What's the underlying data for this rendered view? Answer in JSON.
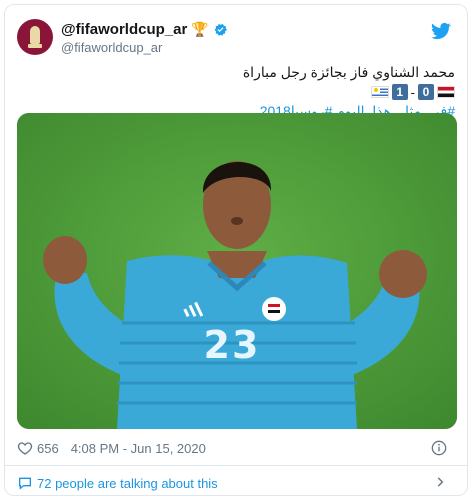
{
  "account": {
    "display_name": "@fifaworldcup_ar",
    "handle": "@fifaworldcup_ar",
    "badge_icon": "trophy-icon",
    "verified_icon": "verified-icon"
  },
  "tweet": {
    "line1": "محمد الشناوي فاز بجائزة رجل مباراة",
    "score": {
      "home": "0",
      "away": "1",
      "separator": "-"
    },
    "hashtags": "#في_مثل_هذا_اليوم #روسيا2018"
  },
  "media": {
    "jersey_number": "23",
    "kit_brand_icon": "adidas-icon",
    "crest_icon": "egypt-crest-icon"
  },
  "footer": {
    "like_count": "656",
    "timestamp": "4:08 PM - Jun 15, 2020",
    "talking_text": "72 people are talking about this"
  },
  "colors": {
    "link": "#1b95e0",
    "muted": "#657786",
    "border": "#e1e8ed",
    "backdrop": "#4f9a3b",
    "jersey": "#3aa9d8"
  }
}
